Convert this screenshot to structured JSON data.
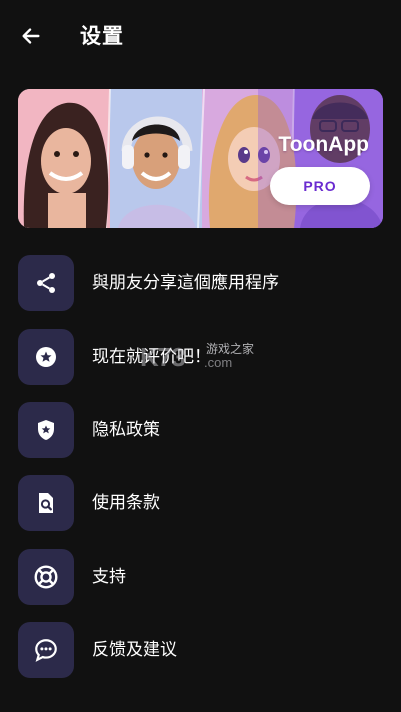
{
  "header": {
    "title": "设置",
    "back_icon": "arrow-left-icon"
  },
  "banner": {
    "brand": "ToonApp",
    "cta": "PRO",
    "accent": "#6a2bd0"
  },
  "menu": {
    "items": [
      {
        "label": "與朋友分享這個應用程序",
        "icon": "share-icon"
      },
      {
        "label": "现在就评价吧！",
        "icon": "star-badge-icon"
      },
      {
        "label": "隐私政策",
        "icon": "shield-star-icon"
      },
      {
        "label": "使用条款",
        "icon": "document-search-icon"
      },
      {
        "label": "支持",
        "icon": "lifebuoy-icon"
      },
      {
        "label": "反馈及建议",
        "icon": "chat-bubble-icon"
      }
    ]
  },
  "watermark": {
    "logo": "K73",
    "name": "游戏之家",
    "domain": ".com"
  },
  "colors": {
    "background": "#111111",
    "tile": "#2c2a4a"
  }
}
